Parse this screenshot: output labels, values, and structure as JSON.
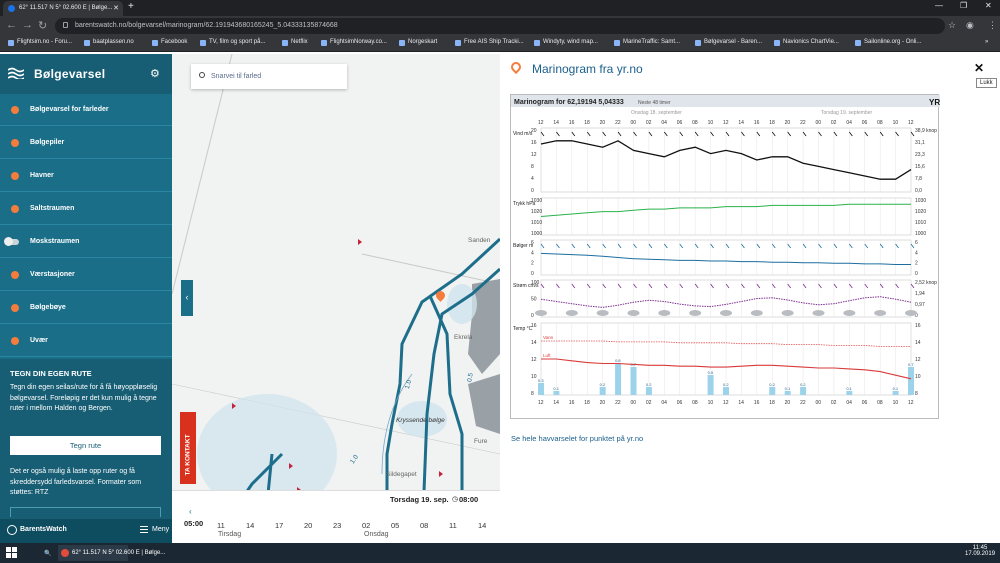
{
  "browser": {
    "tab_title": "62° 11.517 N 5° 02.600 E | Bølge...",
    "url": "barentswatch.no/bolgevarsel/marinogram/62.191943680165245_5.04333135874668",
    "bookmarks": [
      "Flightsim.no - Foru...",
      "baatplassen.no",
      "Facebook",
      "TV, film og sport på...",
      "Netflix",
      "FlightsimNorway.co...",
      "Norgeskart",
      "Free AIS Ship Tracki...",
      "Windyty, wind map...",
      "MarineTraffic: Samt...",
      "Bølgevarsel - Baren...",
      "Navionics ChartVie...",
      "Sailonline.org - Onli..."
    ]
  },
  "sidebar": {
    "logo": "Bølgevarsel",
    "items": [
      {
        "label": "Bølgevarsel for farleder",
        "state": "dot"
      },
      {
        "label": "Bølgepiler",
        "state": "dot"
      },
      {
        "label": "Havner",
        "state": "dot"
      },
      {
        "label": "Saltstraumen",
        "state": "dot"
      },
      {
        "label": "Moskstraumen",
        "state": "toggle"
      },
      {
        "label": "Værstasjoner",
        "state": "dot"
      },
      {
        "label": "Bølgebøye",
        "state": "dot"
      },
      {
        "label": "Uvær",
        "state": "dot"
      }
    ],
    "route": {
      "title": "TEGN DIN EGEN RUTE",
      "text": "Tegn din egen seilas/rute for å få høyoppløselig bølgevarsel. Foreløpig er det kun mulig å tegne ruter i mellom Halden og Bergen.",
      "button": "Tegn rute",
      "text2": "Det er også mulig å laste opp ruter og få skreddersydd farledsvarsel. Formater som støttes: RTZ"
    },
    "footer_logo": "BarentsWatch",
    "footer_menu": "Meny"
  },
  "map": {
    "search_placeholder": "Snarvei til farled",
    "contact": "TA KONTAKT",
    "labels": {
      "sanden": "Sanden",
      "kryssende": "Kryssende bølge",
      "sildegapet": "Sildegapet",
      "fure": "Fure",
      "ekrela": "Ekrela",
      "scale_a": "1.0",
      "scale_b": "0.5",
      "scale_c": "1.0"
    },
    "time": {
      "date": "Torsdag 19. sep.",
      "clock": "08:00",
      "now": "05:00",
      "hours": [
        "11",
        "14",
        "17",
        "20",
        "23",
        "02",
        "05",
        "08",
        "11",
        "14"
      ],
      "day1": "Tirsdag",
      "day2": "Onsdag"
    }
  },
  "panel": {
    "title": "Marinogram fra yr.no",
    "close_tooltip": "Lukk",
    "link": "Se hele havvarselet for punktet på yr.no"
  },
  "chart_data": {
    "type": "line",
    "title": "Marinogram for 62,19194 5,04333",
    "subtitle": "Neste 48 timer",
    "brand": "YR",
    "days": [
      "Onsdag 18. september",
      "Torsdag 19. september"
    ],
    "x_ticks": [
      "12",
      "14",
      "16",
      "18",
      "20",
      "22",
      "00",
      "02",
      "04",
      "06",
      "08",
      "10",
      "12",
      "14",
      "16",
      "18",
      "20",
      "22",
      "00",
      "02",
      "04",
      "06",
      "08",
      "10",
      "12"
    ],
    "panels": [
      {
        "name": "wind",
        "ylabel": "Vind m/s",
        "yticks": [
          "20",
          "16",
          "12",
          "8",
          "4",
          "0"
        ],
        "ylim": [
          0,
          20
        ],
        "rticks": [
          "38,9 knop",
          "31,1",
          "23,3",
          "15,6",
          "7,8",
          "0,0"
        ],
        "color": "#111111",
        "values": [
          15,
          16,
          16,
          15,
          14,
          16,
          13,
          12,
          11,
          13,
          14,
          12,
          13,
          12,
          10,
          11,
          11,
          9,
          8,
          7,
          6,
          5,
          4,
          4,
          7
        ]
      },
      {
        "name": "pressure",
        "ylabel": "Trykk hPa",
        "yticks": [
          "1030",
          "1020",
          "1010",
          "1000"
        ],
        "ylim": [
          1000,
          1030
        ],
        "rticks": [
          "1030",
          "1020",
          "1010",
          "1000"
        ],
        "color": "#2ab24a",
        "values": [
          1015,
          1016,
          1017,
          1018,
          1019,
          1019,
          1020,
          1021,
          1021,
          1022,
          1022,
          1022,
          1023,
          1023,
          1023,
          1024,
          1024,
          1024,
          1024,
          1024,
          1025,
          1025,
          1025,
          1025,
          1025
        ]
      },
      {
        "name": "waves",
        "ylabel": "Bølger m",
        "yticks": [
          "6",
          "4",
          "2",
          "0"
        ],
        "ylim": [
          0,
          6
        ],
        "rticks": [
          "6",
          "4",
          "2",
          "0"
        ],
        "color": "#1b6ea0",
        "values": [
          3.7,
          3.6,
          3.5,
          3.4,
          3.2,
          3.0,
          2.8,
          2.7,
          2.6,
          2.5,
          2.5,
          2.4,
          2.4,
          2.3,
          2.3,
          2.2,
          2.2,
          2.1,
          2.1,
          2.0,
          2.0,
          1.9,
          1.9,
          1.8,
          1.8
        ]
      },
      {
        "name": "current",
        "ylabel": "Strøm cm/s",
        "yticks": [
          "100",
          "50",
          "0"
        ],
        "ylim": [
          0,
          100
        ],
        "rticks": [
          "2,52 knop",
          "1,94",
          "0,97",
          "0"
        ],
        "color": "#7b2d8f",
        "values": [
          48,
          42,
          36,
          30,
          26,
          32,
          40,
          45,
          42,
          35,
          30,
          28,
          34,
          42,
          50,
          52,
          46,
          38,
          33,
          36,
          44,
          52,
          55,
          48,
          40
        ]
      },
      {
        "name": "temp",
        "ylabel": "Temp °C",
        "yticks": [
          "16",
          "14",
          "12",
          "10",
          "8"
        ],
        "ylim": [
          8,
          16
        ],
        "rticks": [
          "16",
          "14",
          "12",
          "10",
          "8"
        ],
        "color": "#d93a3a",
        "series": [
          {
            "name": "Vann",
            "values": [
              14,
              14,
              14,
              14,
              14,
              13.9,
              13.9,
              13.9,
              13.9,
              13.8,
              13.8,
              13.8,
              13.8,
              13.7,
              13.7,
              13.7,
              13.6,
              13.6,
              13.6,
              13.5,
              13.5,
              13.5,
              13.4,
              13.4,
              13.4
            ]
          },
          {
            "name": "Luft",
            "values": [
              12,
              12,
              11.8,
              11.6,
              11.5,
              11.5,
              11.4,
              11.3,
              11.3,
              11.2,
              11.2,
              11.1,
              11.1,
              11.2,
              11.3,
              11.3,
              11.2,
              11.1,
              11.0,
              11.0,
              10.9,
              10.8,
              10.6,
              10.2,
              9.8
            ]
          }
        ],
        "precip": [
          0.3,
          0.1,
          0,
          0,
          0.2,
          0.8,
          0.7,
          0.2,
          0,
          0,
          0,
          0.5,
          0.2,
          0,
          0,
          0.2,
          0.1,
          0.2,
          0,
          0,
          0.1,
          0,
          0,
          0.1,
          0.7
        ]
      }
    ]
  }
}
